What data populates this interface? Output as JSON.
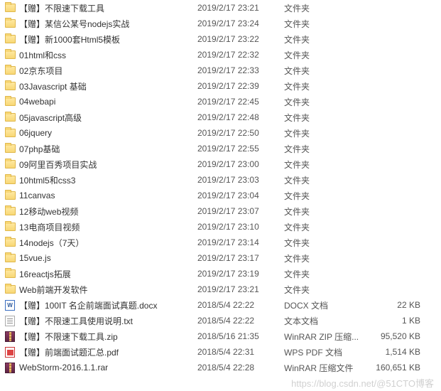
{
  "watermark": "https://blog.csdn.net/@51CTO博客",
  "icons": {
    "folder": "folder",
    "docx": "docx",
    "txt": "txt",
    "rar": "rar",
    "pdf": "pdf"
  },
  "files": [
    {
      "name": "【赠】不限速下载工具",
      "date": "2019/2/17 23:21",
      "type": "文件夹",
      "size": "",
      "icon": "folder"
    },
    {
      "name": "【赠】某信公某号nodejs实战",
      "date": "2019/2/17 23:24",
      "type": "文件夹",
      "size": "",
      "icon": "folder"
    },
    {
      "name": "【赠】新1000套Html5模板",
      "date": "2019/2/17 23:22",
      "type": "文件夹",
      "size": "",
      "icon": "folder"
    },
    {
      "name": "01html和css",
      "date": "2019/2/17 22:32",
      "type": "文件夹",
      "size": "",
      "icon": "folder"
    },
    {
      "name": "02京东项目",
      "date": "2019/2/17 22:33",
      "type": "文件夹",
      "size": "",
      "icon": "folder"
    },
    {
      "name": "03Javascript 基础",
      "date": "2019/2/17 22:39",
      "type": "文件夹",
      "size": "",
      "icon": "folder"
    },
    {
      "name": "04webapi",
      "date": "2019/2/17 22:45",
      "type": "文件夹",
      "size": "",
      "icon": "folder"
    },
    {
      "name": "05javascript高级",
      "date": "2019/2/17 22:48",
      "type": "文件夹",
      "size": "",
      "icon": "folder"
    },
    {
      "name": "06jquery",
      "date": "2019/2/17 22:50",
      "type": "文件夹",
      "size": "",
      "icon": "folder"
    },
    {
      "name": "07php基础",
      "date": "2019/2/17 22:55",
      "type": "文件夹",
      "size": "",
      "icon": "folder"
    },
    {
      "name": "09阿里百秀项目实战",
      "date": "2019/2/17 23:00",
      "type": "文件夹",
      "size": "",
      "icon": "folder"
    },
    {
      "name": "10html5和css3",
      "date": "2019/2/17 23:03",
      "type": "文件夹",
      "size": "",
      "icon": "folder"
    },
    {
      "name": "11canvas",
      "date": "2019/2/17 23:04",
      "type": "文件夹",
      "size": "",
      "icon": "folder"
    },
    {
      "name": "12移动web视频",
      "date": "2019/2/17 23:07",
      "type": "文件夹",
      "size": "",
      "icon": "folder"
    },
    {
      "name": "13电商项目视频",
      "date": "2019/2/17 23:10",
      "type": "文件夹",
      "size": "",
      "icon": "folder"
    },
    {
      "name": "14nodejs（7天）",
      "date": "2019/2/17 23:14",
      "type": "文件夹",
      "size": "",
      "icon": "folder"
    },
    {
      "name": "15vue.js",
      "date": "2019/2/17 23:17",
      "type": "文件夹",
      "size": "",
      "icon": "folder"
    },
    {
      "name": "16reactjs拓展",
      "date": "2019/2/17 23:19",
      "type": "文件夹",
      "size": "",
      "icon": "folder"
    },
    {
      "name": "Web前端开发软件",
      "date": "2019/2/17 23:21",
      "type": "文件夹",
      "size": "",
      "icon": "folder"
    },
    {
      "name": "【赠】100IT 名企前端面试真题.docx",
      "date": "2018/5/4 22:22",
      "type": "DOCX 文档",
      "size": "22 KB",
      "icon": "docx"
    },
    {
      "name": "【赠】不限速工具使用说明.txt",
      "date": "2018/5/4 22:22",
      "type": "文本文档",
      "size": "1 KB",
      "icon": "txt"
    },
    {
      "name": "【赠】不限速下载工具.zip",
      "date": "2018/5/16 21:35",
      "type": "WinRAR ZIP 压缩...",
      "size": "95,520 KB",
      "icon": "rar"
    },
    {
      "name": "【赠】前端面试题汇总.pdf",
      "date": "2018/5/4 22:31",
      "type": "WPS PDF 文档",
      "size": "1,514 KB",
      "icon": "pdf"
    },
    {
      "name": "WebStorm-2016.1.1.rar",
      "date": "2018/5/4 22:28",
      "type": "WinRAR 压缩文件",
      "size": "160,651 KB",
      "icon": "rar"
    }
  ]
}
